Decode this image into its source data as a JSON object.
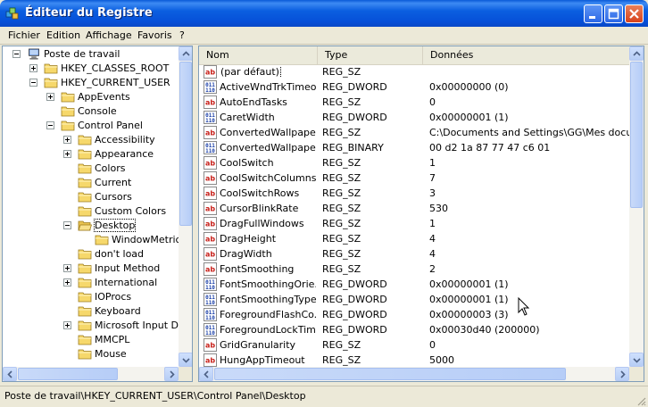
{
  "window": {
    "title": "Éditeur du Registre"
  },
  "menu": {
    "items": [
      "Fichier",
      "Edition",
      "Affichage",
      "Favoris",
      "?"
    ]
  },
  "tree": {
    "items": [
      {
        "label": "Poste de travail",
        "level": 0,
        "expander": "minus"
      },
      {
        "label": "HKEY_CLASSES_ROOT",
        "level": 1,
        "expander": "plus"
      },
      {
        "label": "HKEY_CURRENT_USER",
        "level": 1,
        "expander": "minus"
      },
      {
        "label": "AppEvents",
        "level": 2,
        "expander": "plus"
      },
      {
        "label": "Console",
        "level": 2,
        "expander": "none"
      },
      {
        "label": "Control Panel",
        "level": 2,
        "expander": "minus"
      },
      {
        "label": "Accessibility",
        "level": 3,
        "expander": "plus"
      },
      {
        "label": "Appearance",
        "level": 3,
        "expander": "plus"
      },
      {
        "label": "Colors",
        "level": 3,
        "expander": "none"
      },
      {
        "label": "Current",
        "level": 3,
        "expander": "none"
      },
      {
        "label": "Cursors",
        "level": 3,
        "expander": "none"
      },
      {
        "label": "Custom Colors",
        "level": 3,
        "expander": "none"
      },
      {
        "label": "Desktop",
        "level": 3,
        "expander": "minus",
        "open": true,
        "selected": true
      },
      {
        "label": "WindowMetrics",
        "level": 4,
        "expander": "none"
      },
      {
        "label": "don't load",
        "level": 3,
        "expander": "none"
      },
      {
        "label": "Input Method",
        "level": 3,
        "expander": "plus"
      },
      {
        "label": "International",
        "level": 3,
        "expander": "plus"
      },
      {
        "label": "IOProcs",
        "level": 3,
        "expander": "none"
      },
      {
        "label": "Keyboard",
        "level": 3,
        "expander": "none"
      },
      {
        "label": "Microsoft Input Dev",
        "level": 3,
        "expander": "plus"
      },
      {
        "label": "MMCPL",
        "level": 3,
        "expander": "none"
      },
      {
        "label": "Mouse",
        "level": 3,
        "expander": "none"
      }
    ]
  },
  "list": {
    "columns": [
      "Nom",
      "Type",
      "Données"
    ],
    "rows": [
      {
        "name": "(par défaut)",
        "type": "REG_SZ",
        "data": "",
        "icon": "string-value-icon"
      },
      {
        "name": "ActiveWndTrkTimeout",
        "type": "REG_DWORD",
        "data": "0x00000000 (0)",
        "icon": "binary-value-icon"
      },
      {
        "name": "AutoEndTasks",
        "type": "REG_SZ",
        "data": "0",
        "icon": "string-value-icon"
      },
      {
        "name": "CaretWidth",
        "type": "REG_DWORD",
        "data": "0x00000001 (1)",
        "icon": "binary-value-icon"
      },
      {
        "name": "ConvertedWallpaper",
        "type": "REG_SZ",
        "data": "C:\\Documents and Settings\\GG\\Mes document",
        "icon": "string-value-icon"
      },
      {
        "name": "ConvertedWallpape...",
        "type": "REG_BINARY",
        "data": "00 d2 1a 87 77 47 c6 01",
        "icon": "binary-value-icon"
      },
      {
        "name": "CoolSwitch",
        "type": "REG_SZ",
        "data": "1",
        "icon": "string-value-icon"
      },
      {
        "name": "CoolSwitchColumns",
        "type": "REG_SZ",
        "data": "7",
        "icon": "string-value-icon"
      },
      {
        "name": "CoolSwitchRows",
        "type": "REG_SZ",
        "data": "3",
        "icon": "string-value-icon"
      },
      {
        "name": "CursorBlinkRate",
        "type": "REG_SZ",
        "data": "530",
        "icon": "string-value-icon"
      },
      {
        "name": "DragFullWindows",
        "type": "REG_SZ",
        "data": "1",
        "icon": "string-value-icon"
      },
      {
        "name": "DragHeight",
        "type": "REG_SZ",
        "data": "4",
        "icon": "string-value-icon"
      },
      {
        "name": "DragWidth",
        "type": "REG_SZ",
        "data": "4",
        "icon": "string-value-icon"
      },
      {
        "name": "FontSmoothing",
        "type": "REG_SZ",
        "data": "2",
        "icon": "string-value-icon"
      },
      {
        "name": "FontSmoothingOrie...",
        "type": "REG_DWORD",
        "data": "0x00000001 (1)",
        "icon": "binary-value-icon"
      },
      {
        "name": "FontSmoothingType",
        "type": "REG_DWORD",
        "data": "0x00000001 (1)",
        "icon": "binary-value-icon"
      },
      {
        "name": "ForegroundFlashCo...",
        "type": "REG_DWORD",
        "data": "0x00000003 (3)",
        "icon": "binary-value-icon"
      },
      {
        "name": "ForegroundLockTim...",
        "type": "REG_DWORD",
        "data": "0x00030d40 (200000)",
        "icon": "binary-value-icon"
      },
      {
        "name": "GridGranularity",
        "type": "REG_SZ",
        "data": "0",
        "icon": "string-value-icon"
      },
      {
        "name": "HungAppTimeout",
        "type": "REG_SZ",
        "data": "5000",
        "icon": "string-value-icon"
      }
    ]
  },
  "status": {
    "path": "Poste de travail\\HKEY_CURRENT_USER\\Control Panel\\Desktop"
  },
  "colors": {
    "title_blue": "#0a5ad8",
    "chrome": "#ece9d8",
    "border": "#7f9db9",
    "folder": "#f6d86b"
  }
}
